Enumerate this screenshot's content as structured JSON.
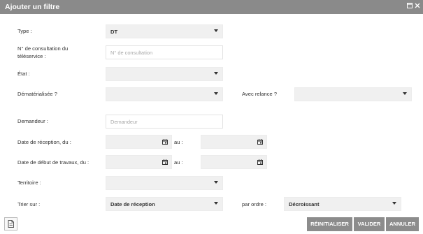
{
  "dialog": {
    "title": "Ajouter un filtre",
    "maximize_icon": "maximize-icon",
    "close_icon": "close-icon"
  },
  "form": {
    "type": {
      "label": "Type :",
      "value": "DT"
    },
    "consultation": {
      "label_line1": "N° de consultation du",
      "label_line2": "téléservice :",
      "placeholder": "N° de consultation",
      "value": ""
    },
    "etat": {
      "label": "État :",
      "value": ""
    },
    "dematerialisee": {
      "label": "Dématérialisée ?",
      "value": ""
    },
    "relance": {
      "label": "Avec relance ?",
      "value": ""
    },
    "demandeur": {
      "label": "Demandeur :",
      "placeholder": "Demandeur",
      "value": ""
    },
    "date_reception": {
      "label": "Date de réception, du :",
      "au_label": "au :",
      "from": "",
      "to": ""
    },
    "date_travaux": {
      "label": "Date de début de travaux, du :",
      "au_label": "au :",
      "from": "",
      "to": ""
    },
    "territoire": {
      "label": "Territoire :",
      "value": ""
    },
    "trier": {
      "label": "Trier sur :",
      "value": "Date de réception",
      "order_label": "par ordre :",
      "order_value": "Décroissant"
    }
  },
  "footer": {
    "reset_label": "RÉINITIALISER",
    "validate_label": "VALIDER",
    "cancel_label": "ANNULER",
    "doc_icon": "document-icon"
  }
}
